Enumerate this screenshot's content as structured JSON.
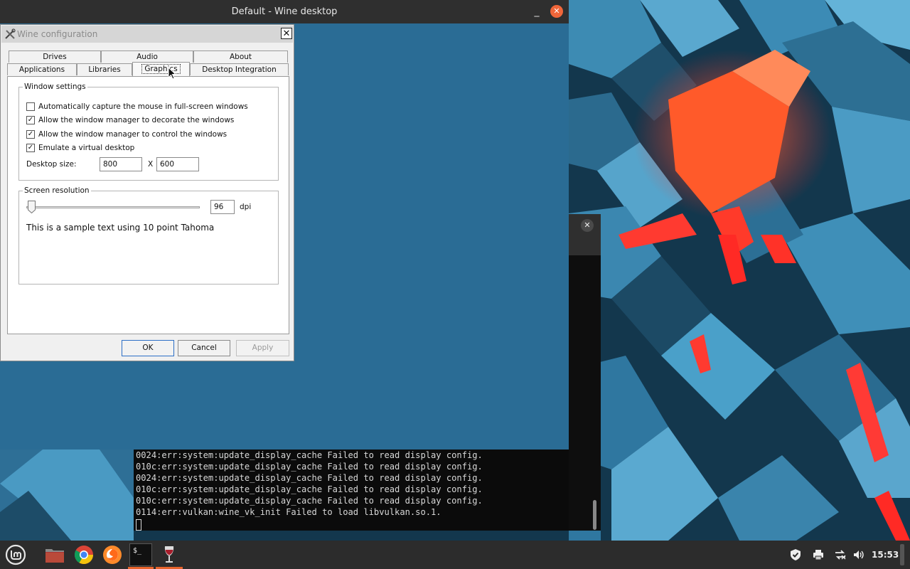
{
  "wine_desktop": {
    "title": "Default - Wine desktop",
    "minimize_glyph": "_",
    "close_glyph": "✕"
  },
  "dialog": {
    "title": "Wine configuration",
    "icon": "wine-config-tools-icon",
    "close_glyph": "✕",
    "tabs_row1": [
      "Drives",
      "Audio",
      "About"
    ],
    "tabs_row2": [
      "Applications",
      "Libraries",
      "Graphics",
      "Desktop Integration"
    ],
    "active_tab": "Graphics",
    "window_settings": {
      "label": "Window settings",
      "options": [
        {
          "label": "Automatically capture the mouse in full-screen windows",
          "checked": false
        },
        {
          "label": "Allow the window manager to decorate the windows",
          "checked": true
        },
        {
          "label": "Allow the window manager to control the windows",
          "checked": true
        },
        {
          "label": "Emulate a virtual desktop",
          "checked": true
        }
      ],
      "desktop_size_label": "Desktop size:",
      "width": "800",
      "separator": "X",
      "height": "600"
    },
    "screen_resolution": {
      "label": "Screen resolution",
      "dpi_value": "96",
      "dpi_unit": "dpi",
      "slider_level": 0.0,
      "sample_text": "This is a sample text using 10 point Tahoma"
    },
    "buttons": {
      "ok": "OK",
      "cancel": "Cancel",
      "apply": "Apply"
    }
  },
  "background_window": {
    "close_glyph": "✕"
  },
  "terminal": {
    "lines": [
      "0024:err:system:update_display_cache Failed to read display config.",
      "010c:err:system:update_display_cache Failed to read display config.",
      "0024:err:system:update_display_cache Failed to read display config.",
      "010c:err:system:update_display_cache Failed to read display config.",
      "010c:err:system:update_display_cache Failed to read display config.",
      "0114:err:vulkan:wine_vk_init Failed to load libvulkan.so.1."
    ]
  },
  "taskbar": {
    "apps": [
      "mint-menu-icon",
      "files-folder-icon",
      "chrome-icon",
      "firefox-icon",
      "terminal-icon",
      "wine-glass-icon"
    ],
    "terminal_glyph": "$_",
    "tray_icons": [
      "shield-icon",
      "printer-icon",
      "network-icon",
      "volume-icon"
    ],
    "time": "15:53",
    "accent": "#e8642c"
  }
}
